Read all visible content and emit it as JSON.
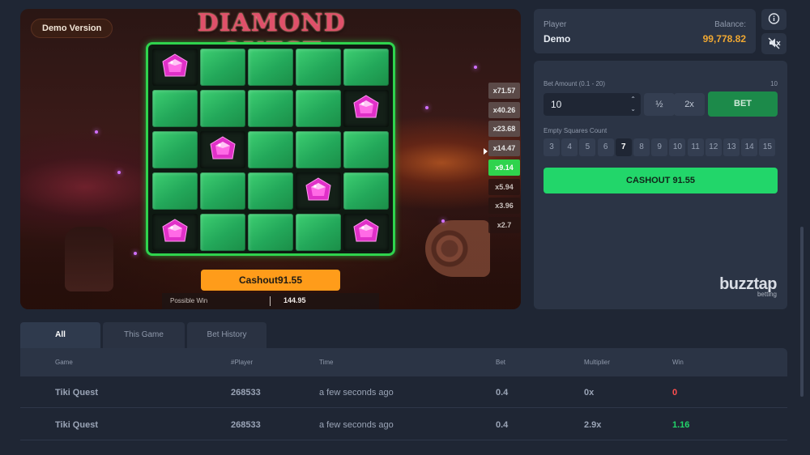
{
  "game": {
    "demo_label": "Demo Version",
    "title": "DIAMOND QUEST",
    "grid": [
      [
        true,
        false,
        false,
        false,
        false
      ],
      [
        false,
        false,
        false,
        false,
        true
      ],
      [
        false,
        true,
        false,
        false,
        false
      ],
      [
        false,
        false,
        false,
        true,
        false
      ],
      [
        true,
        false,
        false,
        false,
        true
      ]
    ],
    "multipliers": [
      "x71.57",
      "x40.26",
      "x23.68",
      "x14.47",
      "x9.14",
      "x5.94",
      "x3.96",
      "x2.7"
    ],
    "current_multiplier_index": 4,
    "cashout_label": "Cashout91.55",
    "possible_win_label": "Possible Win",
    "possible_win_value": "144.95",
    "colors": {
      "gem": "#e030c8",
      "tile": "#2fbf64",
      "board_border": "#2fd34d",
      "cashout": "#ff9c1a"
    }
  },
  "player": {
    "player_label": "Player",
    "name": "Demo",
    "balance_label": "Balance:",
    "balance": "99,778.82"
  },
  "icons": {
    "info": "info-icon",
    "sound": "sound-muted-icon"
  },
  "controls": {
    "bet_amount_label": "Bet Amount (0.1 - 20)",
    "bet_max": "10",
    "bet_value": "10",
    "half_label": "½",
    "double_label": "2x",
    "bet_button": "BET",
    "empty_squares_label": "Empty Squares Count",
    "squares": [
      "3",
      "4",
      "5",
      "6",
      "7",
      "8",
      "9",
      "10",
      "11",
      "12",
      "13",
      "14",
      "15"
    ],
    "selected_square": "7",
    "cashout_label": "CASHOUT 91.55",
    "colors": {
      "cashout": "#22d66a",
      "bet": "#1c8a4a"
    }
  },
  "brand": {
    "name": "buzztap",
    "sub": "betting"
  },
  "history": {
    "tabs": [
      "All",
      "This Game",
      "Bet History"
    ],
    "active_tab": "All",
    "columns": [
      "Game",
      "#Player",
      "Time",
      "Bet",
      "Multiplier",
      "Win"
    ],
    "rows": [
      {
        "game": "Tiki Quest",
        "player": "268533",
        "time": "a few seconds ago",
        "bet": "0.4",
        "multiplier": "0x",
        "win": "0"
      },
      {
        "game": "Tiki Quest",
        "player": "268533",
        "time": "a few seconds ago",
        "bet": "0.4",
        "multiplier": "2.9x",
        "win": "1.16"
      }
    ]
  }
}
